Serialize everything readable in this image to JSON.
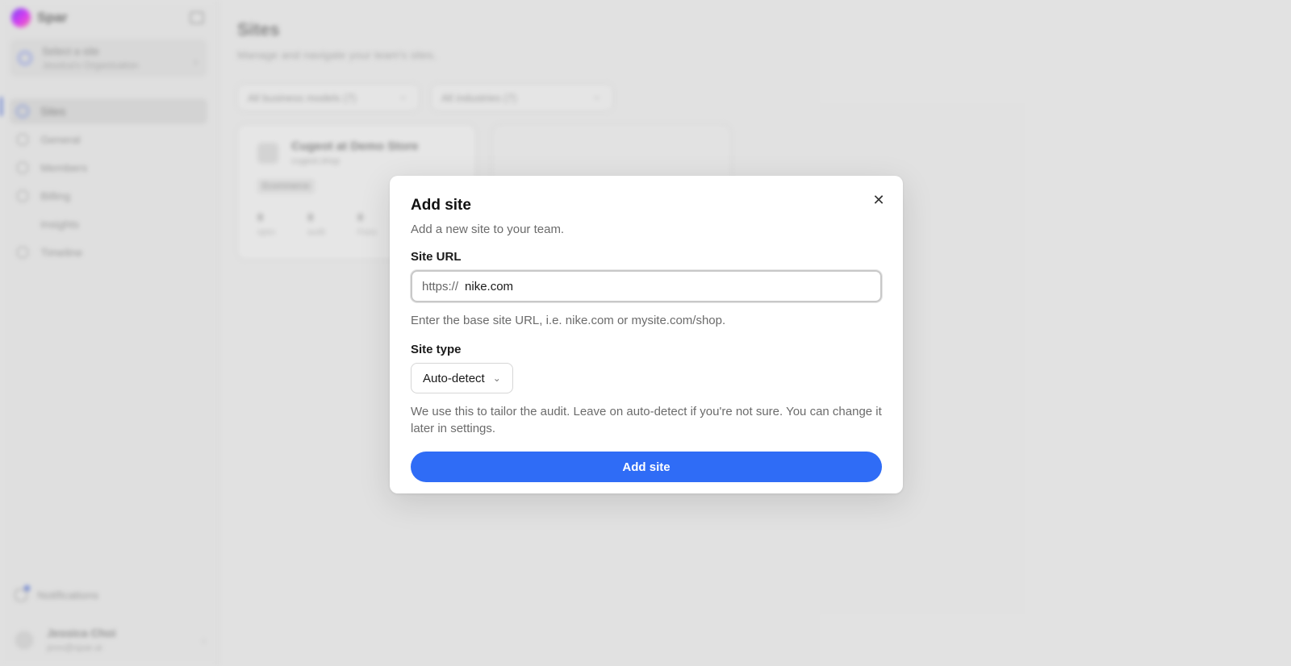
{
  "app": {
    "brand": "Spar",
    "site_switcher": {
      "line1": "Select a site",
      "line2": "Jessica's Organization"
    },
    "nav": [
      {
        "label": "Sites",
        "icon": "globe-icon"
      },
      {
        "label": "General",
        "icon": "wrench-icon"
      },
      {
        "label": "Members",
        "icon": "users-icon"
      },
      {
        "label": "Billing",
        "icon": "card-icon"
      },
      {
        "label": "Insights",
        "icon": "chart-icon"
      },
      {
        "label": "Timeline",
        "icon": "clock-icon"
      }
    ],
    "notifications_label": "Notifications",
    "user": {
      "name": "Jessica Choi",
      "email": "jess@spar.ai"
    }
  },
  "page": {
    "title": "Sites",
    "subtitle": "Manage and navigate your team's sites.",
    "filters": [
      "All business models (7)",
      "All industries (7)"
    ],
    "card": {
      "title": "Cugeot at Demo Store",
      "subtitle": "cugeot.shop",
      "tag": "Ecommerce",
      "stats": [
        {
          "value": "0",
          "label": "open"
        },
        {
          "value": "0",
          "label": "audit"
        },
        {
          "value": "0",
          "label": "Fixes"
        }
      ]
    }
  },
  "modal": {
    "title": "Add site",
    "description": "Add a new site to your team.",
    "url_label": "Site URL",
    "url_prefix": "https://",
    "url_value": "nike.com",
    "url_help": "Enter the base site URL, i.e. nike.com or mysite.com/shop.",
    "type_label": "Site type",
    "type_value": "Auto-detect",
    "type_help": "We use this to tailor the audit. Leave on auto-detect if you're not sure. You can change it later in settings.",
    "submit_label": "Add site",
    "close_glyph": "✕"
  },
  "colors": {
    "primary": "#2f6cf6",
    "backdrop": "#ebebeb"
  }
}
